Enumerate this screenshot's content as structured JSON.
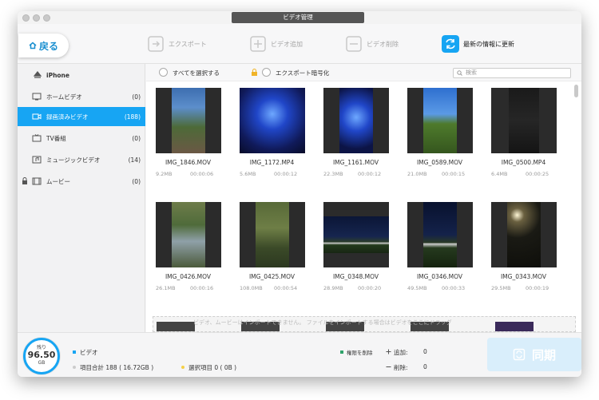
{
  "window": {
    "title": "ビデオ管理"
  },
  "toolbar": {
    "back_label": "戻る",
    "export_label": "エクスポート",
    "add_label": "ビデオ追加",
    "delete_label": "ビデオ削除",
    "refresh_label": "最新の情報に更新"
  },
  "sidebar": {
    "device": "iPhone",
    "items": [
      {
        "label": "ホームビデオ",
        "count": "(0)",
        "icon": "home-video-icon"
      },
      {
        "label": "録画済みビデオ",
        "count": "(188)",
        "icon": "recorded-video-icon"
      },
      {
        "label": "TV番組",
        "count": "(0)",
        "icon": "tv-icon"
      },
      {
        "label": "ミュージックビデオ",
        "count": "(14)",
        "icon": "music-video-icon"
      },
      {
        "label": "ムービー",
        "count": "(0)",
        "icon": "movie-icon"
      }
    ]
  },
  "filter": {
    "select_all": "すべてを選択する",
    "encrypt_export": "エクスポート暗号化",
    "search_placeholder": "検索"
  },
  "videos": [
    {
      "name": "IMG_1846.MOV",
      "size": "9.2MB",
      "duration": "00:00:06"
    },
    {
      "name": "IMG_1172.MP4",
      "size": "5.6MB",
      "duration": "00:00:12"
    },
    {
      "name": "IMG_1161.MOV",
      "size": "22.3MB",
      "duration": "00:00:12"
    },
    {
      "name": "IMG_0589.MOV",
      "size": "21.0MB",
      "duration": "00:00:15"
    },
    {
      "name": "IMG_0500.MP4",
      "size": "6.4MB",
      "duration": "00:00:25"
    },
    {
      "name": "IMG_0426.MOV",
      "size": "26.1MB",
      "duration": "00:00:16"
    },
    {
      "name": "IMG_0425.MOV",
      "size": "108.0MB",
      "duration": "00:00:54"
    },
    {
      "name": "IMG_0348.MOV",
      "size": "28.9MB",
      "duration": "00:00:20"
    },
    {
      "name": "IMG_0346.MOV",
      "size": "49.5MB",
      "duration": "00:00:33"
    },
    {
      "name": "IMG_0343.MOV",
      "size": "29.5MB",
      "duration": "00:00:19"
    }
  ],
  "drop_hint": "ビデオ、ムービーはインポートできません。 ファイルをインポートする場合はビデオをここにドラッグ",
  "status": {
    "remaining_label": "残り",
    "remaining_value": "96.50",
    "remaining_unit": "GB",
    "video_label": "ビデオ",
    "total_items": "項目合計 188 ( 16.72GB )",
    "selected_items": "選択項目 0 ( 0B )",
    "permanent_delete": "権限を削除",
    "add_label": "追加:",
    "add_value": "0",
    "delete_label": "削除:",
    "delete_value": "0",
    "sync_label": "同期"
  },
  "colors": {
    "accent": "#17a5f3",
    "sync_bg": "#d9eefb"
  }
}
